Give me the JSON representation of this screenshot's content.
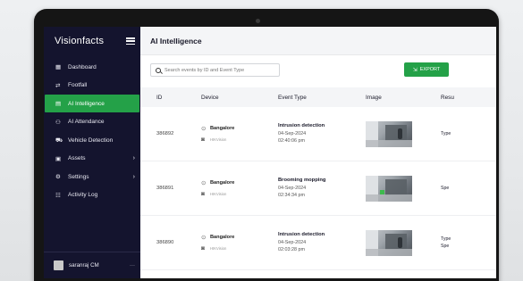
{
  "sidebar": {
    "brand": "Visionfacts",
    "items": [
      {
        "label": "Dashboard",
        "icon": "grid-icon",
        "glyph": "▦",
        "active": false,
        "chevron": ""
      },
      {
        "label": "Footfall",
        "icon": "footfall-icon",
        "glyph": "⇄",
        "active": false,
        "chevron": ""
      },
      {
        "label": "AI Intelligence",
        "icon": "ai-intelligence-icon",
        "glyph": "▤",
        "active": true,
        "chevron": ""
      },
      {
        "label": "AI Attendance",
        "icon": "attendance-icon",
        "glyph": "⚇",
        "active": false,
        "chevron": ""
      },
      {
        "label": "Vehicle Detection",
        "icon": "vehicle-icon",
        "glyph": "⛟",
        "active": false,
        "chevron": ""
      },
      {
        "label": "Assets",
        "icon": "assets-icon",
        "glyph": "▣",
        "active": false,
        "chevron": "›"
      },
      {
        "label": "Settings",
        "icon": "settings-icon",
        "glyph": "⚙",
        "active": false,
        "chevron": "›"
      },
      {
        "label": "Activity Log",
        "icon": "activity-log-icon",
        "glyph": "☷",
        "active": false,
        "chevron": ""
      }
    ],
    "user": {
      "name": "saranraj CM",
      "more": "···"
    }
  },
  "main": {
    "title": "AI Intelligence",
    "search_placeholder": "Search events by ID and Event Type",
    "export_label": "EXPORT",
    "columns": {
      "id": "ID",
      "device": "Device",
      "event_type": "Event Type",
      "image": "Image",
      "result": "Resu"
    },
    "rows": [
      {
        "id": "386892",
        "location": "Bangalore",
        "camera": "HIKVision",
        "event_type": "Intrusion detection",
        "date": "04-Sep-2024",
        "time": "02:40:06 pm",
        "result": "Type",
        "result2": ""
      },
      {
        "id": "386891",
        "location": "Bangalore",
        "camera": "HIKVision",
        "event_type": "Brooming mopping",
        "date": "04-Sep-2024",
        "time": "02:34:34 pm",
        "result": "Spe",
        "result2": ""
      },
      {
        "id": "386890",
        "location": "Bangalore",
        "camera": "HIKVision",
        "event_type": "Intrusion detection",
        "date": "04-Sep-2024",
        "time": "02:03:28 pm",
        "result": "Type",
        "result2": "Spe"
      }
    ]
  },
  "colors": {
    "sidebar_bg": "#14142e",
    "accent": "#24a148"
  }
}
